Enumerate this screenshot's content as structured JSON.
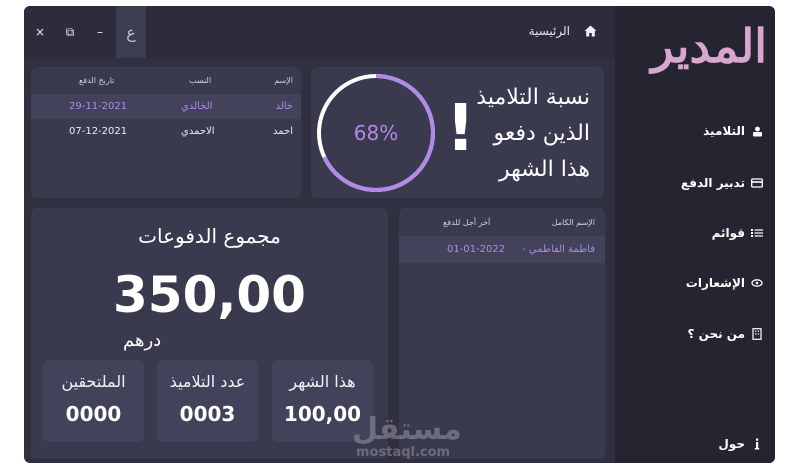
{
  "window_controls": {
    "close": "×",
    "restore": "⧉",
    "minimize": "–",
    "language": "ع"
  },
  "breadcrumb": {
    "home": "الرئيسية"
  },
  "logo": "المدير",
  "sidebar": {
    "items": [
      {
        "label": "التلاميذ",
        "icon": "student-icon"
      },
      {
        "label": "تدبير الدفع",
        "icon": "payment-icon"
      },
      {
        "label": "قوائم",
        "icon": "list-icon"
      },
      {
        "label": "الإشعارات",
        "icon": "notification-icon"
      },
      {
        "label": "من نحن ؟",
        "icon": "building-icon"
      },
      {
        "label": "حول",
        "icon": "info-icon"
      }
    ]
  },
  "payments_table": {
    "headers": [
      "الإسم",
      "النسب",
      "تاريخ الدفع"
    ],
    "rows": [
      {
        "name": "خالد",
        "family": "الخالدي",
        "date": "29-11-2021",
        "highlight": true
      },
      {
        "name": "احمد",
        "family": "الاحمدي",
        "date": "07-12-2021",
        "highlight": false
      }
    ]
  },
  "percentage_card": {
    "lines": [
      "نسبة التلاميذ",
      "الذين دفعو",
      "هذا الشهر"
    ],
    "exclaim": "!",
    "percent": 68,
    "percent_label": "68%"
  },
  "totals_card": {
    "title": "مجموع الدفوعات",
    "amount": "350,00",
    "currency": "درهم",
    "stats": [
      {
        "label": "الملتحقين",
        "value": "0000"
      },
      {
        "label": "عدد التلاميذ",
        "value": "0003"
      },
      {
        "label": "هذا الشهر",
        "value": "100,00"
      }
    ]
  },
  "deadline_table": {
    "headers": [
      "الإسم الكامل",
      "آخر أجل للدفع"
    ],
    "rows": [
      {
        "name": "- فاطمة الفاطمي",
        "date": "01-01-2022"
      }
    ]
  },
  "watermark": {
    "arabic": "مستقل",
    "latin": "mostaql.com"
  },
  "colors": {
    "accent": "#b18ae8",
    "background": "#303041",
    "card": "#3a3a4e",
    "sidebar": "#252532",
    "logo": "#d8a6cf"
  }
}
